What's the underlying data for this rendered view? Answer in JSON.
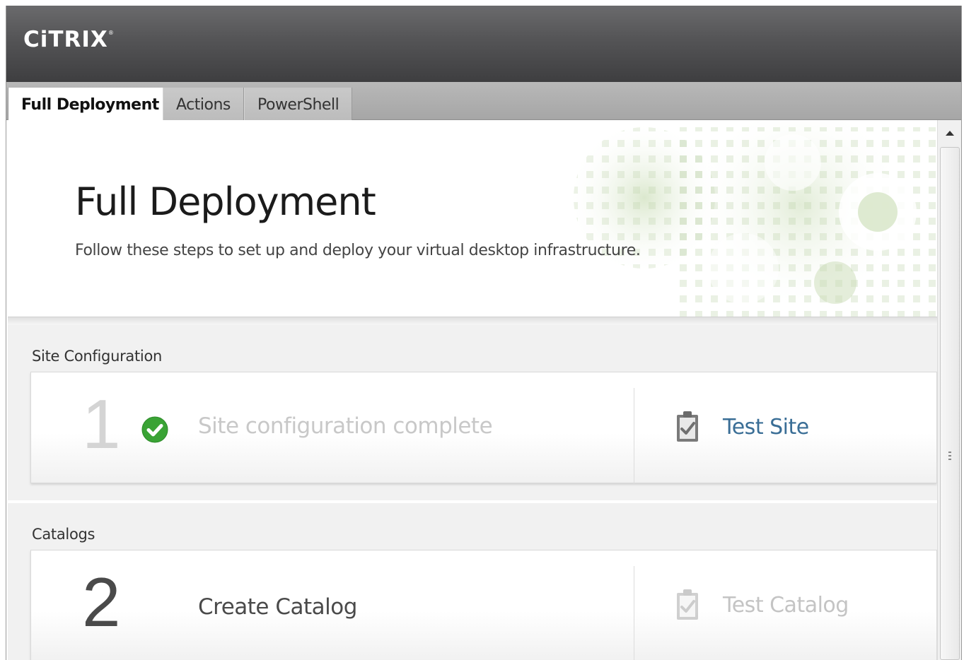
{
  "app": {
    "logo_text": "CiTRIX",
    "logo_mark": "®"
  },
  "tabs": [
    {
      "label": "Full Deployment",
      "active": true
    },
    {
      "label": "Actions",
      "active": false
    },
    {
      "label": "PowerShell",
      "active": false
    }
  ],
  "hero": {
    "title": "Full Deployment",
    "subtitle": "Follow these steps to set up and deploy your virtual desktop infrastructure."
  },
  "sections": [
    {
      "label": "Site Configuration",
      "step_number": "1",
      "step_text": "Site configuration complete",
      "step_completed": true,
      "action_label": "Test Site",
      "action_enabled": true
    },
    {
      "label": "Catalogs",
      "step_number": "2",
      "step_text": "Create Catalog",
      "step_completed": false,
      "action_label": "Test Catalog",
      "action_enabled": false
    }
  ],
  "colors": {
    "titlebar": "#4a4a4c",
    "check_green": "#3aa335",
    "link_blue": "#3a6e96",
    "disabled_gray": "#c4c4c4",
    "decor_green": "#b9cfa5"
  },
  "icons": {
    "status": "check-circle-icon",
    "test": "clipboard-check-icon",
    "scroll_up": "arrow-up-icon"
  }
}
